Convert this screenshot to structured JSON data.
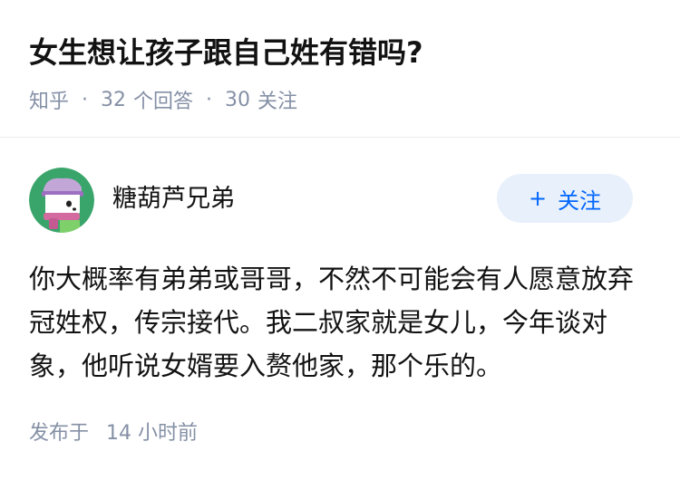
{
  "question": {
    "title": "女生想让孩子跟自己姓有错吗?",
    "source": "知乎",
    "answers_count": "32",
    "answers_label": "个回答",
    "followers_count": "30",
    "followers_label": "关注",
    "separator": "·"
  },
  "answer": {
    "author": {
      "name": "糖葫芦兄弟",
      "avatar_icon": "cartoon-animal-avatar-icon"
    },
    "follow_button": {
      "plus": "+",
      "label": "关注"
    },
    "content": "你大概率有弟弟或哥哥，不然不可能会有人愿意放弃冠姓权，传宗接代。我二叔家就是女儿，今年谈对象，他听说女婿要入赘他家，那个乐的。",
    "published_label": "发布于",
    "published_time": "14 小时前"
  },
  "colors": {
    "accent": "#0066ff",
    "accent_bg": "#e8f0fb",
    "meta_gray": "#8590a6",
    "text": "#121212",
    "avatar_bg": "#3aa56a"
  }
}
